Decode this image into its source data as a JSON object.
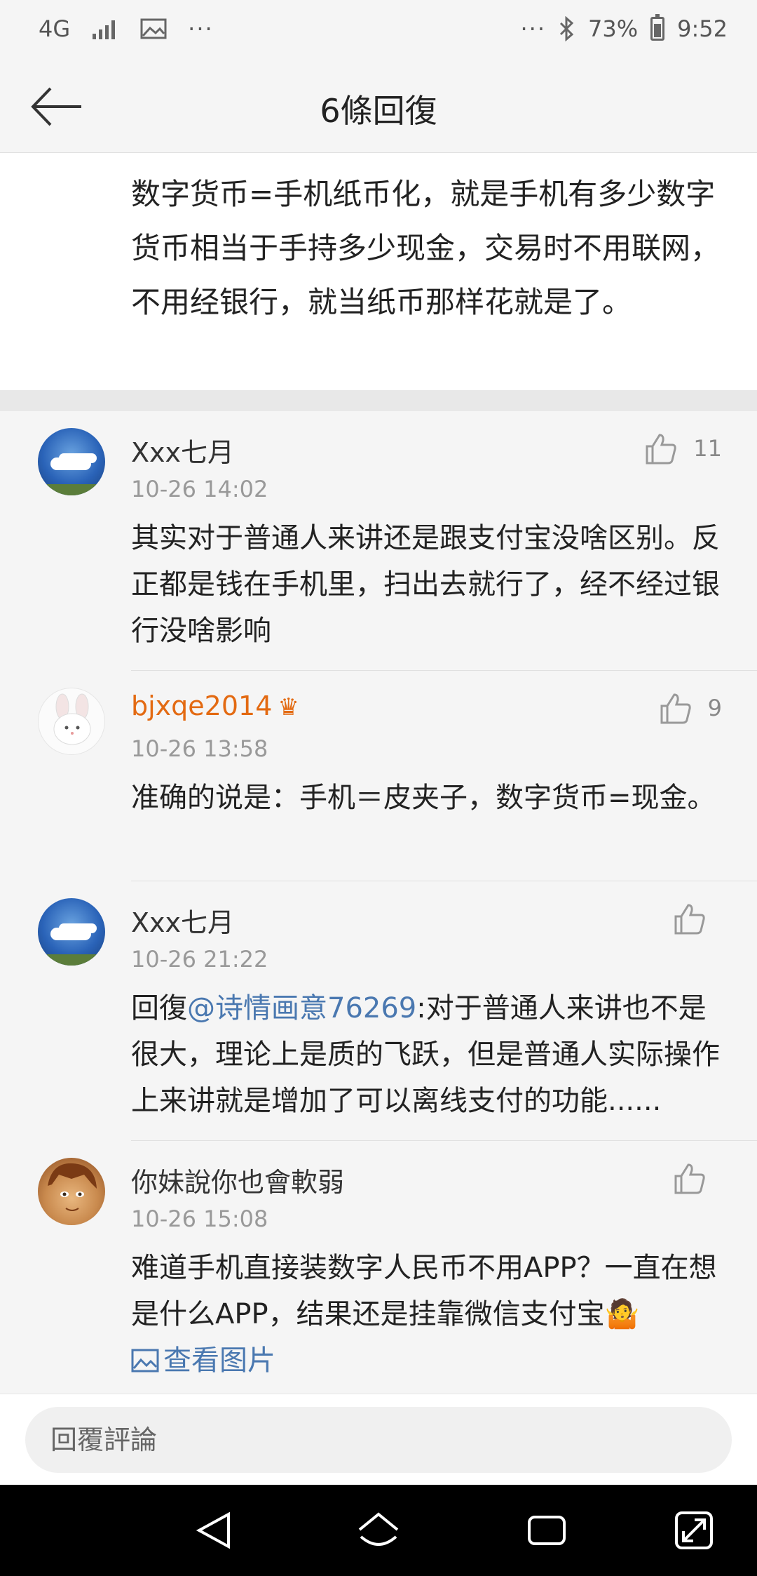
{
  "status_bar": {
    "network": "4G",
    "dots_left": "···",
    "dots_right": "···",
    "battery_level": 0.73,
    "battery_text": "73%",
    "time": "9:52"
  },
  "header": {
    "title": "6條回復"
  },
  "post": {
    "text": "数字货币=手机纸币化，就是手机有多少数字货币相当于手持多少现金，交易时不用联网，不用经银行，就当纸币那样花就是了。"
  },
  "comments": [
    {
      "user": "Xxx七月",
      "time": "10-26 14:02",
      "likes": "11",
      "text": "其实对于普通人来讲还是跟支付宝没啥区别。反正都是钱在手机里，扫出去就行了，经不经过银行没啥影响"
    },
    {
      "user": "bjxqe2014",
      "time": "10-26 13:58",
      "likes": "9",
      "text": "准确的说是：手机＝皮夹子，数字货币=现金。"
    },
    {
      "user": "Xxx七月",
      "time": "10-26 21:22",
      "likes": "",
      "reply_prefix": "回復",
      "mention": "@诗情画意76269",
      "text": ":对于普通人来讲也不是很大，理论上是质的飞跃，但是普通人实际操作上来讲就是增加了可以离线支付的功能......"
    },
    {
      "user": "你妹說你也會軟弱",
      "time": "10-26 15:08",
      "likes": "",
      "text": "难道手机直接装数字人民币不用APP？一直在想是什么APP，结果还是挂靠微信支付宝",
      "view_image": "查看图片"
    }
  ],
  "reply_box": {
    "placeholder": "回覆評論"
  },
  "icons": {
    "back": "back-arrow-icon",
    "like": "thumbs-up-icon",
    "crown": "vip-crown-icon",
    "image": "image-icon",
    "nav_back": "triangle-back-icon",
    "nav_home": "home-icon",
    "nav_recent": "recent-apps-icon",
    "nav_expand": "expand-icon"
  },
  "colors": {
    "accent_link": "#4a78b0",
    "vip_name": "#e36a12",
    "meta_text": "#999999"
  }
}
